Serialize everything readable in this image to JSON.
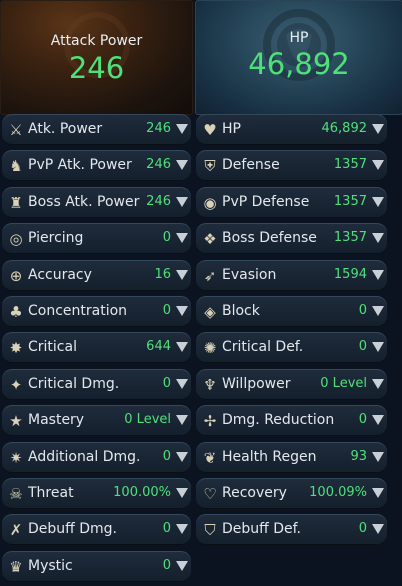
{
  "headers": {
    "attack": {
      "title": "Attack Power",
      "value": "246"
    },
    "hp": {
      "title": "HP",
      "value": "46,892"
    }
  },
  "left": [
    {
      "label": "Atk. Power",
      "value": "246",
      "icon": "crossed-swords-icon"
    },
    {
      "label": "PvP Atk. Power",
      "value": "246",
      "icon": "pvp-attack-icon"
    },
    {
      "label": "Boss Atk. Power",
      "value": "246",
      "icon": "boss-attack-icon"
    },
    {
      "label": "Piercing",
      "value": "0",
      "icon": "piercing-icon"
    },
    {
      "label": "Accuracy",
      "value": "16",
      "icon": "accuracy-icon"
    },
    {
      "label": "Concentration",
      "value": "0",
      "icon": "concentration-icon"
    },
    {
      "label": "Critical",
      "value": "644",
      "icon": "critical-icon"
    },
    {
      "label": "Critical Dmg.",
      "value": "0",
      "icon": "critical-damage-icon"
    },
    {
      "label": "Mastery",
      "value": "0 Level",
      "icon": "mastery-icon"
    },
    {
      "label": "Additional Dmg.",
      "value": "0",
      "icon": "additional-damage-icon"
    },
    {
      "label": "Threat",
      "value": "100.00%",
      "icon": "threat-skull-icon"
    },
    {
      "label": "Debuff Dmg.",
      "value": "0",
      "icon": "debuff-damage-icon"
    },
    {
      "label": "Mystic",
      "value": "0",
      "icon": "mystic-icon"
    }
  ],
  "right": [
    {
      "label": "HP",
      "value": "46,892",
      "icon": "heart-icon"
    },
    {
      "label": "Defense",
      "value": "1357",
      "icon": "shield-icon"
    },
    {
      "label": "PvP Defense",
      "value": "1357",
      "icon": "pvp-defense-icon"
    },
    {
      "label": "Boss Defense",
      "value": "1357",
      "icon": "boss-defense-icon"
    },
    {
      "label": "Evasion",
      "value": "1594",
      "icon": "evasion-icon"
    },
    {
      "label": "Block",
      "value": "0",
      "icon": "block-icon"
    },
    {
      "label": "Critical Def.",
      "value": "0",
      "icon": "critical-defense-icon"
    },
    {
      "label": "Willpower",
      "value": "0 Level",
      "icon": "willpower-icon"
    },
    {
      "label": "Dmg. Reduction",
      "value": "0",
      "icon": "damage-reduction-icon"
    },
    {
      "label": "Health Regen",
      "value": "93",
      "icon": "health-regen-icon"
    },
    {
      "label": "Recovery",
      "value": "100.09%",
      "icon": "recovery-icon"
    },
    {
      "label": "Debuff Def.",
      "value": "0",
      "icon": "debuff-defense-icon"
    }
  ],
  "colors": {
    "value_green": "#4fe07a",
    "label": "#e4e8ee"
  }
}
